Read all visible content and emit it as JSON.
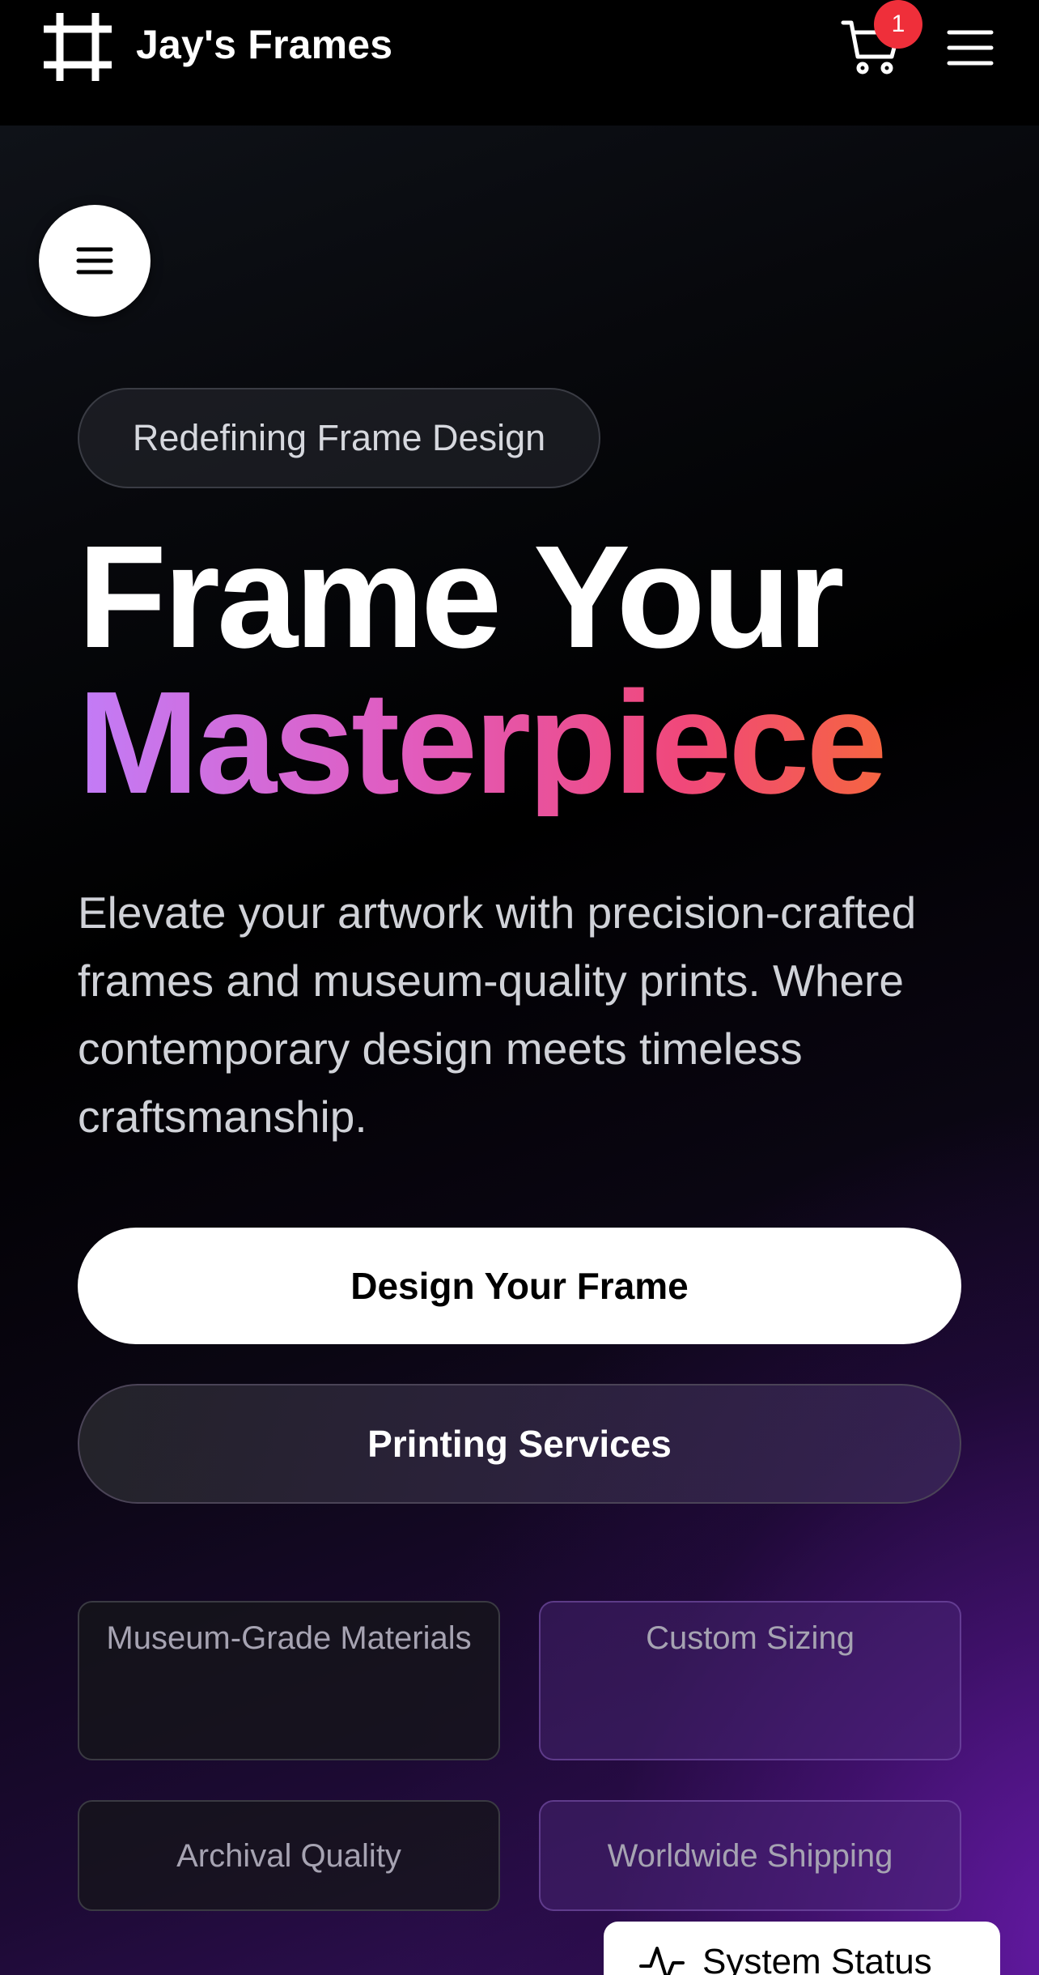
{
  "header": {
    "brand": "Jay's Frames",
    "logo_icon": "hashtag-frame-icon",
    "cart_count": "1",
    "cart_icon": "cart-icon",
    "menu_icon": "hamburger-icon"
  },
  "side_menu": {
    "icon": "hamburger-icon"
  },
  "hero": {
    "pill": "Redefining Frame Design",
    "title_line1": "Frame Your",
    "title_line2": "Masterpiece",
    "title_gradient": [
      "#c27cf7",
      "#e15cbf",
      "#f0487a",
      "#f9761e"
    ],
    "lede": "Elevate your artwork with precision-crafted frames and museum-quality prints. Where contemporary design meets timeless craftsmanship.",
    "primary_cta": "Design Your Frame",
    "secondary_cta": "Printing Services"
  },
  "features": [
    {
      "label": "Museum-Grade Materials"
    },
    {
      "label": "Custom Sizing"
    },
    {
      "label": "Archival Quality"
    },
    {
      "label": "Worldwide Shipping"
    }
  ],
  "status_widget": {
    "label": "System Status",
    "icon": "activity-icon"
  },
  "colors": {
    "badge": "#ef2f3a",
    "accent_purple": "#681aaa"
  }
}
